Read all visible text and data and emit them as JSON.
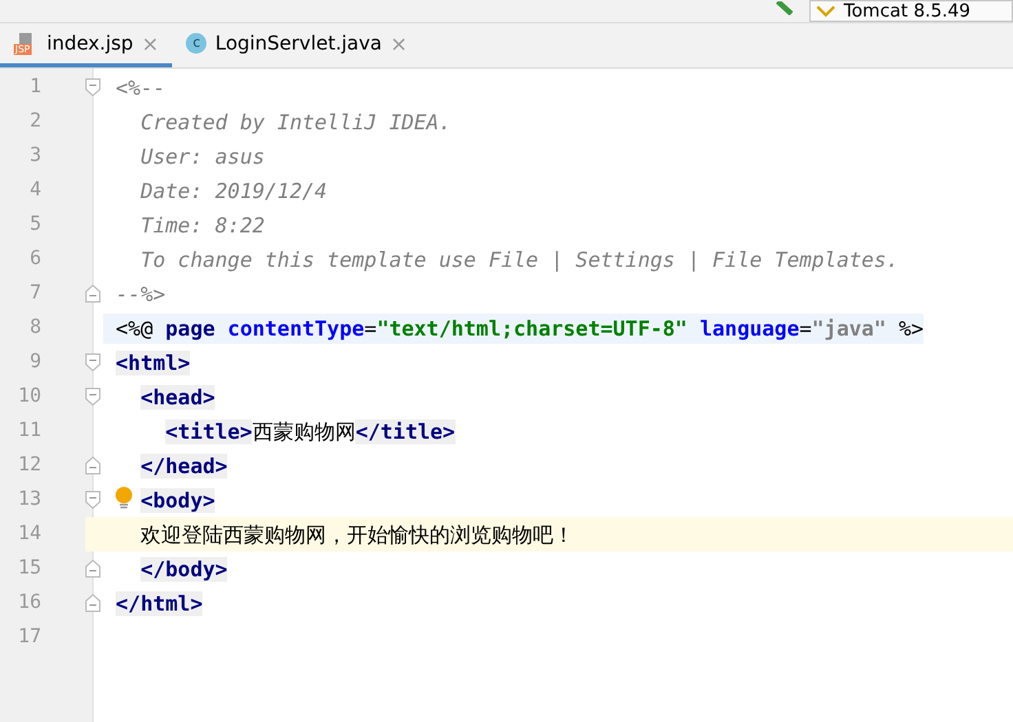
{
  "toolbar": {
    "run_config": "Tomcat 8.5.49"
  },
  "tabs": [
    {
      "label": "index.jsp",
      "kind": "jsp",
      "badge": "JSP",
      "selected": true,
      "close": "×"
    },
    {
      "label": "LoginServlet.java",
      "kind": "class",
      "badge": "c",
      "selected": false,
      "close": "×"
    }
  ],
  "lines": [
    {
      "number": "1",
      "kind": "fold_start",
      "current": false,
      "bulb": false,
      "directive": false,
      "tokens": [
        {
          "kind": "comment",
          "text": "<%--"
        }
      ]
    },
    {
      "number": "2",
      "kind": "plain",
      "current": false,
      "bulb": false,
      "directive": false,
      "tokens": [
        {
          "kind": "comment",
          "text": "  Created by IntelliJ IDEA."
        }
      ]
    },
    {
      "number": "3",
      "kind": "plain",
      "current": false,
      "bulb": false,
      "directive": false,
      "tokens": [
        {
          "kind": "comment",
          "text": "  User: asus"
        }
      ]
    },
    {
      "number": "4",
      "kind": "plain",
      "current": false,
      "bulb": false,
      "directive": false,
      "tokens": [
        {
          "kind": "comment",
          "text": "  Date: 2019/12/4"
        }
      ]
    },
    {
      "number": "5",
      "kind": "plain",
      "current": false,
      "bulb": false,
      "directive": false,
      "tokens": [
        {
          "kind": "comment",
          "text": "  Time: 8:22"
        }
      ]
    },
    {
      "number": "6",
      "kind": "plain",
      "current": false,
      "bulb": false,
      "directive": false,
      "tokens": [
        {
          "kind": "comment",
          "text": "  To change this template use File | Settings | File Templates."
        }
      ]
    },
    {
      "number": "7",
      "kind": "fold_end",
      "current": false,
      "bulb": false,
      "directive": false,
      "tokens": [
        {
          "kind": "comment",
          "text": "--%>"
        }
      ]
    },
    {
      "number": "8",
      "kind": "plain",
      "current": false,
      "bulb": false,
      "directive": true,
      "tokens": [
        {
          "kind": "delim",
          "text": "<%@"
        },
        {
          "kind": "keyword",
          "text": " page"
        },
        {
          "kind": "attr",
          "text": " contentType"
        },
        {
          "kind": "punct",
          "text": "="
        },
        {
          "kind": "string",
          "text": "\"text/html;charset=UTF-8\""
        },
        {
          "kind": "attr",
          "text": " language"
        },
        {
          "kind": "punct",
          "text": "="
        },
        {
          "kind": "value",
          "text": "\"java\""
        },
        {
          "kind": "delim",
          "text": " %>"
        }
      ]
    },
    {
      "number": "9",
      "kind": "fold_start",
      "current": false,
      "bulb": false,
      "directive": false,
      "tokens": [
        {
          "kind": "tag",
          "text": "<html>"
        }
      ]
    },
    {
      "number": "10",
      "kind": "fold_start",
      "current": false,
      "bulb": false,
      "directive": false,
      "tokens": [
        {
          "kind": "indent"
        },
        {
          "kind": "tag",
          "text": "<head>"
        }
      ]
    },
    {
      "number": "11",
      "kind": "plain",
      "current": false,
      "bulb": false,
      "directive": false,
      "tokens": [
        {
          "kind": "indent"
        },
        {
          "kind": "indent"
        },
        {
          "kind": "tag",
          "text": "<title>"
        },
        {
          "kind": "text",
          "text": "西蒙购物网"
        },
        {
          "kind": "tag",
          "text": "</title>"
        }
      ]
    },
    {
      "number": "12",
      "kind": "fold_end",
      "current": false,
      "bulb": false,
      "directive": false,
      "tokens": [
        {
          "kind": "indent"
        },
        {
          "kind": "tag",
          "text": "</head>"
        }
      ]
    },
    {
      "number": "13",
      "kind": "fold_start",
      "current": false,
      "bulb": true,
      "directive": false,
      "tokens": [
        {
          "kind": "indent"
        },
        {
          "kind": "tag",
          "text": "<body>"
        }
      ]
    },
    {
      "number": "14",
      "kind": "plain",
      "current": true,
      "bulb": false,
      "directive": false,
      "tokens": [
        {
          "kind": "indent"
        },
        {
          "kind": "text",
          "text": "欢迎登陆西蒙购物网，开始愉快的浏览购物吧！"
        }
      ]
    },
    {
      "number": "15",
      "kind": "fold_end",
      "current": false,
      "bulb": false,
      "directive": false,
      "tokens": [
        {
          "kind": "indent"
        },
        {
          "kind": "tag",
          "text": "</body>"
        }
      ]
    },
    {
      "number": "16",
      "kind": "fold_end",
      "current": false,
      "bulb": false,
      "directive": false,
      "tokens": [
        {
          "kind": "tag",
          "text": "</html>"
        }
      ]
    },
    {
      "number": "17",
      "kind": "plain",
      "current": false,
      "bulb": false,
      "directive": false
    }
  ]
}
